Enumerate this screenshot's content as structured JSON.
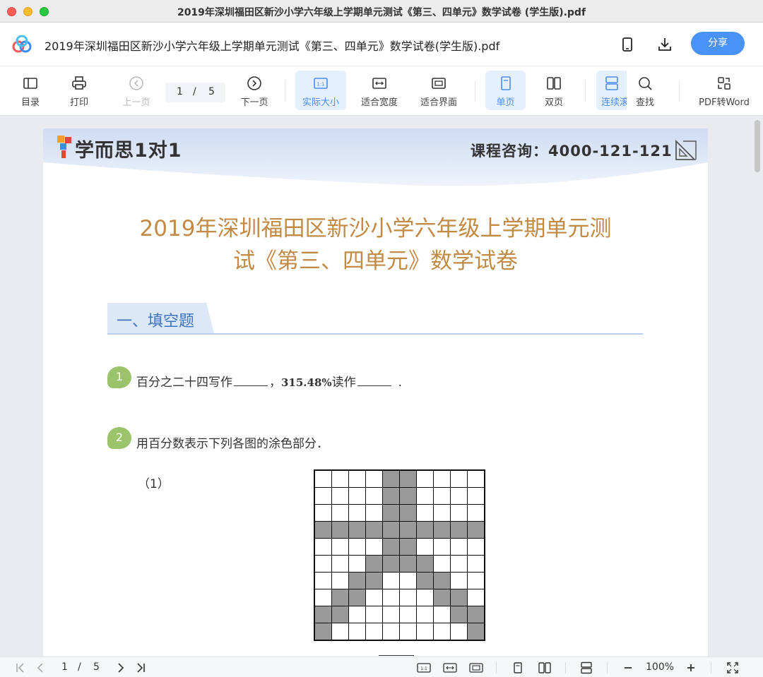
{
  "window": {
    "title": "2019年深圳福田区新沙小学六年级上学期单元测试《第三、四单元》数学试卷 (学生版).pdf"
  },
  "appbar": {
    "doc_title": "2019年深圳福田区新沙小学六年级上学期单元测试《第三、四单元》数学试卷(学生版).pdf",
    "share_label": "分享",
    "icons": [
      "app-logo-icon",
      "phone-icon",
      "download-icon"
    ]
  },
  "toolbar": {
    "toc": "目录",
    "print": "打印",
    "prev": "上一页",
    "page_current": "1",
    "page_sep": "/",
    "page_total": "5",
    "next": "下一页",
    "actual_size": "实际大小",
    "fit_width": "适合宽度",
    "fit_page": "适合界面",
    "single_page": "单页",
    "double_page": "双页",
    "continuous": "连续滚",
    "search": "查找",
    "pdf_to_word": "PDF转Word"
  },
  "document": {
    "brand": "学而思1对1",
    "hotline": "课程咨询：4000-121-121",
    "title_line1": "2019年深圳福田区新沙小学六年级上学期单元测",
    "title_line2": "试《第三、四单元》数学试卷",
    "section1": "一、填空题",
    "q1": {
      "num": "1",
      "part1": "百分之二十四写作",
      "part2": "，",
      "value": "315.48%",
      "part3": "读作",
      "part4": "."
    },
    "q2": {
      "num": "2",
      "text": "用百分数表示下列各图的涂色部分．",
      "sub1": "（1）",
      "grid1_shaded": [
        [
          0,
          0,
          0,
          0,
          1,
          1,
          0,
          0,
          0,
          0
        ],
        [
          0,
          0,
          0,
          0,
          1,
          1,
          0,
          0,
          0,
          0
        ],
        [
          0,
          0,
          0,
          0,
          1,
          1,
          0,
          0,
          0,
          0
        ],
        [
          1,
          1,
          1,
          1,
          1,
          1,
          1,
          1,
          1,
          1
        ],
        [
          0,
          0,
          0,
          0,
          1,
          1,
          0,
          0,
          0,
          0
        ],
        [
          0,
          0,
          0,
          1,
          1,
          1,
          1,
          0,
          0,
          0
        ],
        [
          0,
          0,
          1,
          1,
          0,
          0,
          1,
          1,
          0,
          0
        ],
        [
          0,
          1,
          1,
          0,
          0,
          0,
          0,
          1,
          1,
          0
        ],
        [
          1,
          1,
          0,
          0,
          0,
          0,
          0,
          0,
          1,
          1
        ],
        [
          1,
          0,
          0,
          0,
          0,
          0,
          0,
          0,
          0,
          1
        ]
      ]
    }
  },
  "statusbar": {
    "page_current": "1",
    "page_sep": "/",
    "page_total": "5",
    "zoom": "100%"
  },
  "colors": {
    "accent": "#4a93f6",
    "title_orange": "#c28a44",
    "section_blue": "#3d73bf",
    "question_green": "#9ac36a",
    "shaded_cell": "#9a9a9a"
  }
}
